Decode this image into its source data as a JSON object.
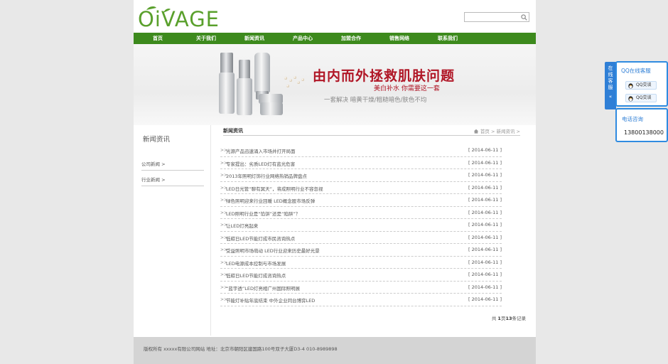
{
  "header": {
    "logo_text": "OiVAGE",
    "search": {
      "placeholder": "",
      "value": ""
    }
  },
  "nav": [
    "首页",
    "关于我们",
    "新闻资讯",
    "产品中心",
    "加盟合作",
    "销售网络",
    "联系我们"
  ],
  "banner": {
    "title": "由内而外拯救肌肤问题",
    "subtitle": "美白补水  你需要这一套",
    "tagline": "一套解决 暗黄干燥/粗糙暗色/肤色不均"
  },
  "sidebar": {
    "title": "新闻资讯",
    "items": [
      {
        "label": "公司新闻  >"
      },
      {
        "label": "行业新闻  >"
      }
    ]
  },
  "content": {
    "section_title": "新闻资讯",
    "breadcrumb": "首页 > 新闻资讯 >",
    "rows": [
      {
        "title": "光源产品迅速涌入市场并打开局面",
        "date": "[ 2014-06-11 ]"
      },
      {
        "title": "专家提出：劣质LED灯有蓝光危害",
        "date": "[ 2014-06-11 ]"
      },
      {
        "title": "2013年照明灯饰行业网络热销品牌盘点",
        "date": "[ 2014-06-11 ]"
      },
      {
        "title": "LED日光管“聊有冥天”，将成照明行业不容忽视",
        "date": "[ 2014-06-11 ]"
      },
      {
        "title": "绿色照明迎来行业回暖 LED概念股市场反弹",
        "date": "[ 2014-06-11 ]"
      },
      {
        "title": "LED照明行业是“馅饼”还是“陷阱”？",
        "date": "[ 2014-06-11 ]"
      },
      {
        "title": "让LED灯亮起来",
        "date": "[ 2014-06-11 ]"
      },
      {
        "title": "低碳日LED节能灯成市民咨询热点",
        "date": "[ 2014-06-11 ]"
      },
      {
        "title": "受益照明市场萌动 LED行业迎来历史最好光景",
        "date": "[ 2014-06-11 ]"
      },
      {
        "title": "LED电源成本控制与市场发展",
        "date": "[ 2014-06-11 ]"
      },
      {
        "title": "低碳日LED节能灯成咨询热点",
        "date": "[ 2014-06-11 ]"
      },
      {
        "title": "“蓝宇透”LED灯亮相广州国际照明展",
        "date": "[ 2014-06-11 ]"
      },
      {
        "title": "节能灯补贴年底结束 中外企业同台博弈LED",
        "date": "[ 2014-06-11 ]"
      }
    ],
    "pager": {
      "prefix": "共 ",
      "current": "1",
      "mid": "页",
      "total": "13",
      "suffix": "条记录"
    }
  },
  "footer": {
    "text": "版权所有 xxxxx有限公司网站  地址：北京市朝阳区建国路100号双子大厦D3-4 010-8989898"
  },
  "float_service": {
    "tab_label": "在线客服",
    "qq_title": "QQ在线客服",
    "qq_buttons": [
      "QQ交谈",
      "QQ交谈"
    ],
    "phone_title": "电话咨询",
    "phone_number": "13800138000"
  },
  "colors": {
    "nav_green": "#3d8a1d",
    "logo_green": "#5aa02c",
    "banner_red": "#b01626",
    "service_blue": "#2f8be0"
  }
}
